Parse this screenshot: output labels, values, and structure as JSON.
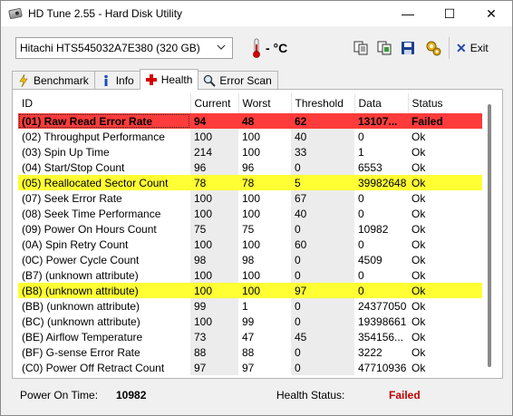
{
  "window": {
    "title": "HD Tune 2.55 - Hard Disk Utility",
    "minimize": "—",
    "maximize": "☐",
    "close": "✕"
  },
  "toolbar": {
    "drive": "Hitachi HTS545032A7E380 (320 GB)",
    "temperature": "- °C",
    "exit_label": "Exit"
  },
  "tabs": [
    {
      "label": "Benchmark"
    },
    {
      "label": "Info"
    },
    {
      "label": "Health"
    },
    {
      "label": "Error Scan"
    }
  ],
  "table": {
    "columns": [
      "ID",
      "Current",
      "Worst",
      "Threshold",
      "Data",
      "Status"
    ],
    "rows": [
      {
        "id": "(01) Raw Read Error Rate",
        "current": "94",
        "worst": "48",
        "threshold": "62",
        "data": "13107...",
        "status": "Failed",
        "style": "failed"
      },
      {
        "id": "(02) Throughput Performance",
        "current": "100",
        "worst": "100",
        "threshold": "40",
        "data": "0",
        "status": "Ok",
        "style": ""
      },
      {
        "id": "(03) Spin Up Time",
        "current": "214",
        "worst": "100",
        "threshold": "33",
        "data": "1",
        "status": "Ok",
        "style": ""
      },
      {
        "id": "(04) Start/Stop Count",
        "current": "96",
        "worst": "96",
        "threshold": "0",
        "data": "6553",
        "status": "Ok",
        "style": ""
      },
      {
        "id": "(05) Reallocated Sector Count",
        "current": "78",
        "worst": "78",
        "threshold": "5",
        "data": "39982648",
        "status": "Ok",
        "style": "warn"
      },
      {
        "id": "(07) Seek Error Rate",
        "current": "100",
        "worst": "100",
        "threshold": "67",
        "data": "0",
        "status": "Ok",
        "style": ""
      },
      {
        "id": "(08) Seek Time Performance",
        "current": "100",
        "worst": "100",
        "threshold": "40",
        "data": "0",
        "status": "Ok",
        "style": ""
      },
      {
        "id": "(09) Power On Hours Count",
        "current": "75",
        "worst": "75",
        "threshold": "0",
        "data": "10982",
        "status": "Ok",
        "style": ""
      },
      {
        "id": "(0A) Spin Retry Count",
        "current": "100",
        "worst": "100",
        "threshold": "60",
        "data": "0",
        "status": "Ok",
        "style": ""
      },
      {
        "id": "(0C) Power Cycle Count",
        "current": "98",
        "worst": "98",
        "threshold": "0",
        "data": "4509",
        "status": "Ok",
        "style": ""
      },
      {
        "id": "(B7) (unknown attribute)",
        "current": "100",
        "worst": "100",
        "threshold": "0",
        "data": "0",
        "status": "Ok",
        "style": ""
      },
      {
        "id": "(B8) (unknown attribute)",
        "current": "100",
        "worst": "100",
        "threshold": "97",
        "data": "0",
        "status": "Ok",
        "style": "warn"
      },
      {
        "id": "(BB) (unknown attribute)",
        "current": "99",
        "worst": "1",
        "threshold": "0",
        "data": "24377050",
        "status": "Ok",
        "style": ""
      },
      {
        "id": "(BC) (unknown attribute)",
        "current": "100",
        "worst": "99",
        "threshold": "0",
        "data": "19398661",
        "status": "Ok",
        "style": ""
      },
      {
        "id": "(BE) Airflow Temperature",
        "current": "73",
        "worst": "47",
        "threshold": "45",
        "data": "354156...",
        "status": "Ok",
        "style": ""
      },
      {
        "id": "(BF) G-sense Error Rate",
        "current": "88",
        "worst": "88",
        "threshold": "0",
        "data": "3222",
        "status": "Ok",
        "style": ""
      },
      {
        "id": "(C0) Power Off Retract Count",
        "current": "97",
        "worst": "97",
        "threshold": "0",
        "data": "47710936",
        "status": "Ok",
        "style": ""
      }
    ]
  },
  "status_bar": {
    "power_on_label": "Power On Time:",
    "power_on_value": "10982",
    "health_label": "Health Status:",
    "health_value": "Failed"
  },
  "colors": {
    "failed_row": "#ff3b3b",
    "warning_row": "#ffff33",
    "failed_text": "#c00000"
  }
}
